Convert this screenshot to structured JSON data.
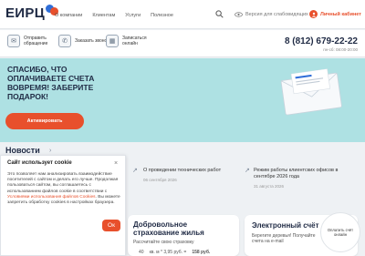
{
  "header": {
    "logo_text": "ЕИРЦ",
    "nav": [
      "О компании",
      "Клиентам",
      "Услуги",
      "Полезное"
    ],
    "accessibility": "Версия для слабовидящих",
    "login": "Личный кабинет"
  },
  "services": [
    {
      "icon": "envelope-icon",
      "label": "Отправить обращение"
    },
    {
      "icon": "phone-icon",
      "label": "Заказать звонок"
    },
    {
      "icon": "calendar-icon",
      "label": "Записаться онлайн"
    }
  ],
  "contact": {
    "phone": "8 (812) 679-22-22",
    "hours": "пн-сб: 08:00-20:00"
  },
  "banner": {
    "title": "СПАСИБО, ЧТО ОПЛАЧИВАЕТЕ СЧЕТА ВОВРЕМЯ! ЗАБЕРИТЕ ПОДАРОК!",
    "button": "Активировать"
  },
  "news": {
    "title": "Новости",
    "items": [
      {
        "text": "О проведении технических работ",
        "date": "06 сентября 2026"
      },
      {
        "text": "Режим работы клиентских офисов в сентябре 2026 года",
        "date": "31 августа 2026"
      }
    ]
  },
  "cards": [
    {
      "title": "Добровольное страхование жилья",
      "text": "Рассчитайте свою страховку",
      "calc_area": "40",
      "calc_rate": "кв. м * 3,95 руб. =",
      "calc_total": "158 руб."
    },
    {
      "title": "Электронный счёт",
      "text": "Берегите деревья! Получайте счета на e-mail"
    }
  ],
  "cookie": {
    "title": "Сайт использует cookie",
    "close": "×",
    "text_before": "Это позволяет нам анализировать взаимодействие посетителей с сайтом и делать его лучше. Продолжая пользоваться сайтом, вы соглашаетесь с использованием файлов cookie в соответствии с ",
    "link": "Условиями использования файлов Cookies",
    "text_after": ". Вы можете запретить обработку cookies в настройках браузера.",
    "ok": "Ок"
  },
  "badge": {
    "text": "Оплатить счёт онлайн"
  },
  "colors": {
    "accent": "#e8502c",
    "banner": "#aee1e3",
    "text_dark": "#1f2a44"
  }
}
